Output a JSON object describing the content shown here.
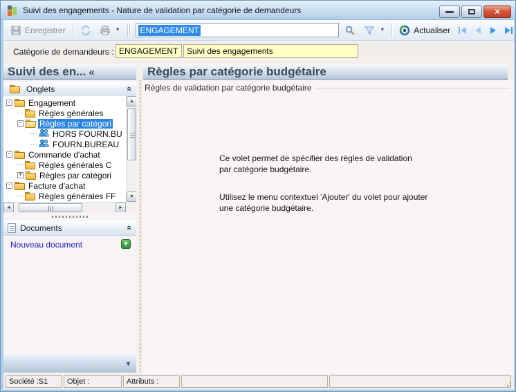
{
  "window": {
    "title": "Suivi des engagements -  Nature de validation par catégorie de demandeurs"
  },
  "toolbar": {
    "save_label": "Enregistrer",
    "search_value": "ENGAGEMENT",
    "refresh_label": "Actualiser"
  },
  "form": {
    "category_label": "Catégorie de demandeurs :",
    "category_code": "ENGAGEMENT",
    "category_name": "Suivi des engagements"
  },
  "sidebar": {
    "header_title": "Suivi des en...",
    "onglets_label": "Onglets",
    "documents_label": "Documents",
    "new_document_label": "Nouveau document",
    "tree": [
      {
        "label": "Engagement",
        "expander": "-",
        "icon": "folder"
      },
      {
        "label": "Règles générales",
        "expander": "",
        "icon": "folder"
      },
      {
        "label": "Règles par catégori",
        "expander": "-",
        "icon": "folder-open",
        "selected": true
      },
      {
        "label": "HORS FOURN.BU",
        "expander": "",
        "icon": "users"
      },
      {
        "label": "FOURN.BUREAU",
        "expander": "",
        "icon": "users"
      },
      {
        "label": "Commande d'achat",
        "expander": "-",
        "icon": "folder"
      },
      {
        "label": "Règles générales C",
        "expander": "",
        "icon": "folder"
      },
      {
        "label": "Règles par catégori",
        "expander": "+",
        "icon": "folder"
      },
      {
        "label": "Facture d'achat",
        "expander": "-",
        "icon": "folder"
      },
      {
        "label": "Règles générales FF",
        "expander": "",
        "icon": "folder"
      }
    ]
  },
  "main": {
    "header_title": "Règles par catégorie budgétaire",
    "group_legend": "Règles de validation par catégorie budgétaire",
    "info_line1": "Ce volet permet de spécifier des règles de validation",
    "info_line2": "par catégorie budgétaire.",
    "info_line3": "Utilisez le menu contextuel 'Ajouter' du volet pour ajouter",
    "info_line4": "une catégorie budgétaire."
  },
  "statusbar": {
    "societe": "Société :S1",
    "objet": "Objet :",
    "attributs": "Attributs :"
  },
  "icons": {
    "collapse_left": "«",
    "dropdown_arrow": "▼",
    "panel_collapse_arrow": "▼",
    "scroll_up": "▲",
    "scroll_down": "▼",
    "scroll_left": "◄",
    "scroll_right": "►",
    "plus": "+"
  },
  "colors": {
    "accent_blue": "#2b85e2",
    "field_yellow": "#ffffc6",
    "link_blue": "#2121c8",
    "header_text": "#3e4b59"
  }
}
